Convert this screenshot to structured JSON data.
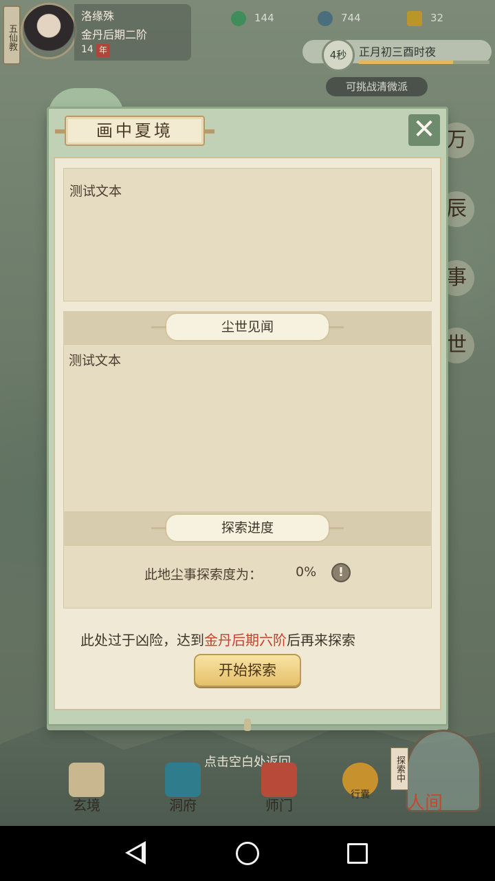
{
  "hud": {
    "sect": "五仙教",
    "character": {
      "name": "洛缘殊",
      "rank": "金丹后期二阶",
      "age": "14",
      "age_badge": "年"
    },
    "resources": [
      {
        "icon": "jade-icon",
        "value": "144",
        "color": "#3e8d5a"
      },
      {
        "icon": "spirit-stone-icon",
        "value": "744",
        "color": "#4b6e7c"
      },
      {
        "icon": "gold-ingot-icon",
        "value": "32",
        "color": "#b8962a"
      }
    ],
    "timer": {
      "countdown": "4秒",
      "date": "正月初三酉时夜",
      "progress": 0.72
    },
    "challenge_label": "可挑战清微派"
  },
  "side_chars": [
    "万",
    "辰",
    "事",
    "世"
  ],
  "modal": {
    "title": "画中夏境",
    "close_symbol": "✕",
    "description": "测试文本",
    "section_world": "尘世见闻",
    "world_text": "测试文本",
    "section_progress": "探索进度",
    "progress_label": "此地尘事探索度为：",
    "progress_value": "0%",
    "info_symbol": "!",
    "warning_prefix": "此处过于凶险，达到",
    "warning_highlight": "金丹后期六阶",
    "warning_suffix": "后再来探索",
    "start_button": "开始探索"
  },
  "return_hint": "点击空白处返回",
  "bottom_nav": [
    {
      "label": "玄境",
      "color": "#c9b88f"
    },
    {
      "label": "洞府",
      "color": "#2f7d8c"
    },
    {
      "label": "师门",
      "color": "#b84a3a"
    },
    {
      "label": "行囊",
      "color": "#c7922e"
    }
  ],
  "explore": {
    "tag": "探索中",
    "label": "人间"
  },
  "colors": {
    "accent_red": "#c8402e",
    "frame_green": "#c1d1b6",
    "paper": "#f0e9d5"
  }
}
